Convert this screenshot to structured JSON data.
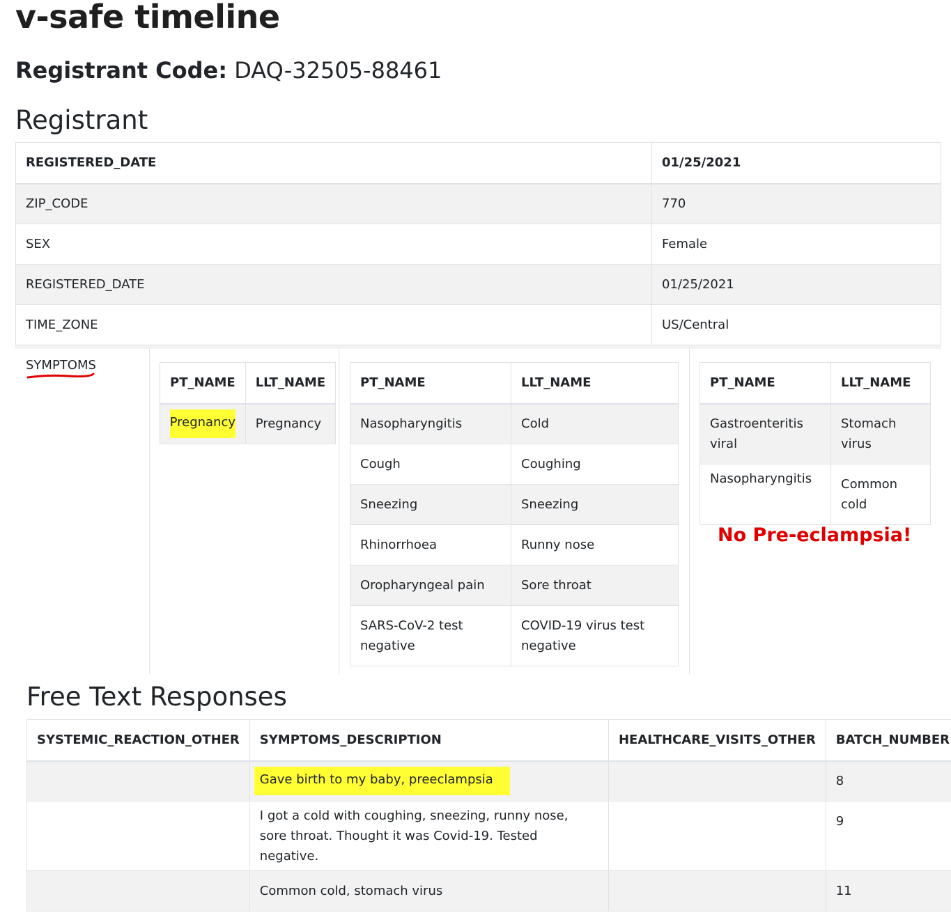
{
  "page": {
    "title": "v-safe timeline",
    "registrant_code_label": "Registrant Code:",
    "registrant_code_value": "DAQ-32505-88461",
    "registrant_heading": "Registrant",
    "free_text_heading": "Free Text Responses"
  },
  "registrant_table": {
    "header": {
      "key": "REGISTERED_DATE",
      "value": "01/25/2021"
    },
    "rows": [
      {
        "key": "ZIP_CODE",
        "value": "770"
      },
      {
        "key": "SEX",
        "value": "Female"
      },
      {
        "key": "REGISTERED_DATE",
        "value": "01/25/2021"
      },
      {
        "key": "TIME_ZONE",
        "value": "US/Central"
      }
    ],
    "symptoms_label": "SYMPTOMS"
  },
  "symptom_tables": [
    {
      "col_pt": "PT_NAME",
      "col_llt": "LLT_NAME",
      "rows": [
        {
          "pt": "Pregnancy",
          "llt": "Pregnancy"
        }
      ]
    },
    {
      "col_pt": "PT_NAME",
      "col_llt": "LLT_NAME",
      "rows": [
        {
          "pt": "Nasopharyngitis",
          "llt": "Cold"
        },
        {
          "pt": "Cough",
          "llt": "Coughing"
        },
        {
          "pt": "Sneezing",
          "llt": "Sneezing"
        },
        {
          "pt": "Rhinorrhoea",
          "llt": "Runny nose"
        },
        {
          "pt": "Oropharyngeal pain",
          "llt": "Sore throat"
        },
        {
          "pt": "SARS-CoV-2 test negative",
          "llt": "COVID-19 virus test negative"
        }
      ]
    },
    {
      "col_pt": "PT_NAME",
      "col_llt": "LLT_NAME",
      "rows": [
        {
          "pt": "Gastroenteritis viral",
          "llt": "Stomach virus"
        },
        {
          "pt": "Nasopharyngitis",
          "llt": "Common cold"
        }
      ]
    }
  ],
  "annotation": {
    "text": "No Pre-eclampsia!",
    "color": "#e00000",
    "highlight_color": "#ffff33"
  },
  "free_text_table": {
    "columns": [
      "SYSTEMIC_REACTION_OTHER",
      "SYMPTOMS_DESCRIPTION",
      "HEALTHCARE_VISITS_OTHER",
      "BATCH_NUMBER"
    ],
    "rows": [
      {
        "systemic": "",
        "description": "Gave birth to my baby, preeclampsia",
        "healthcare": "",
        "batch": "8"
      },
      {
        "systemic": "",
        "description": "I got a cold with coughing, sneezing, runny nose, sore throat. Thought it was Covid-19. Tested negative.",
        "healthcare": "",
        "batch": "9"
      },
      {
        "systemic": "",
        "description": "Common cold, stomach virus",
        "healthcare": "",
        "batch": "11"
      }
    ]
  }
}
